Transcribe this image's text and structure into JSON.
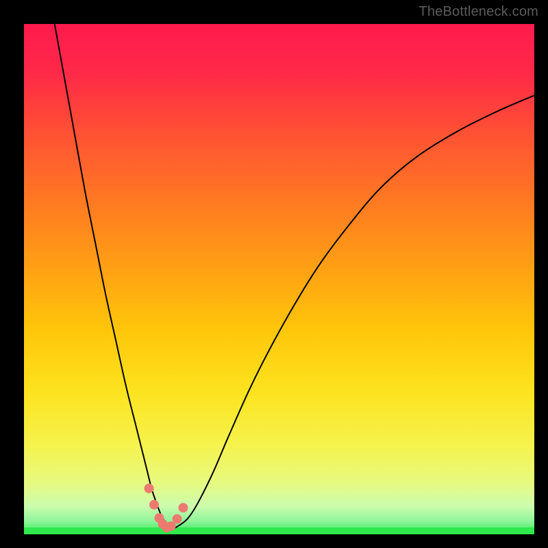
{
  "watermark": "TheBottleneck.com",
  "colors": {
    "frame": "#000000",
    "curve": "#000000",
    "marker": "#ed7a71",
    "green_band": "#2fe94d",
    "gradient_stops": [
      {
        "offset": 0.0,
        "color": "#ff1a4e"
      },
      {
        "offset": 0.1,
        "color": "#ff2a47"
      },
      {
        "offset": 0.22,
        "color": "#ff5333"
      },
      {
        "offset": 0.35,
        "color": "#ff7a22"
      },
      {
        "offset": 0.48,
        "color": "#ffa114"
      },
      {
        "offset": 0.6,
        "color": "#ffc60a"
      },
      {
        "offset": 0.72,
        "color": "#fce31f"
      },
      {
        "offset": 0.82,
        "color": "#f6f24a"
      },
      {
        "offset": 0.9,
        "color": "#e6fa80"
      },
      {
        "offset": 0.945,
        "color": "#ccfcae"
      },
      {
        "offset": 0.975,
        "color": "#8df59a"
      },
      {
        "offset": 1.0,
        "color": "#2fe94d"
      }
    ]
  },
  "chart_data": {
    "type": "line",
    "title": "",
    "xlabel": "",
    "ylabel": "",
    "xlim": [
      0,
      100
    ],
    "ylim": [
      0,
      100
    ],
    "series": [
      {
        "name": "bottleneck-curve",
        "x": [
          6,
          8,
          10,
          12,
          14,
          16,
          18,
          20,
          22,
          24,
          25,
          26,
          27,
          28,
          29,
          30,
          32,
          34,
          37,
          40,
          44,
          48,
          53,
          58,
          64,
          70,
          77,
          85,
          93,
          100
        ],
        "y": [
          100,
          89,
          78,
          67,
          57,
          47,
          38,
          29,
          21,
          13,
          9,
          6,
          3.5,
          2,
          1.2,
          1.5,
          3,
          6,
          12,
          19,
          28,
          36,
          45,
          53,
          61,
          68,
          74,
          79,
          83,
          86
        ]
      }
    ],
    "markers": {
      "name": "trough-points",
      "x": [
        24.5,
        25.5,
        26.5,
        27.2,
        28.0,
        28.8,
        30.0,
        31.2
      ],
      "y": [
        9.0,
        5.8,
        3.2,
        2.0,
        1.3,
        1.6,
        3.0,
        5.2
      ]
    }
  }
}
